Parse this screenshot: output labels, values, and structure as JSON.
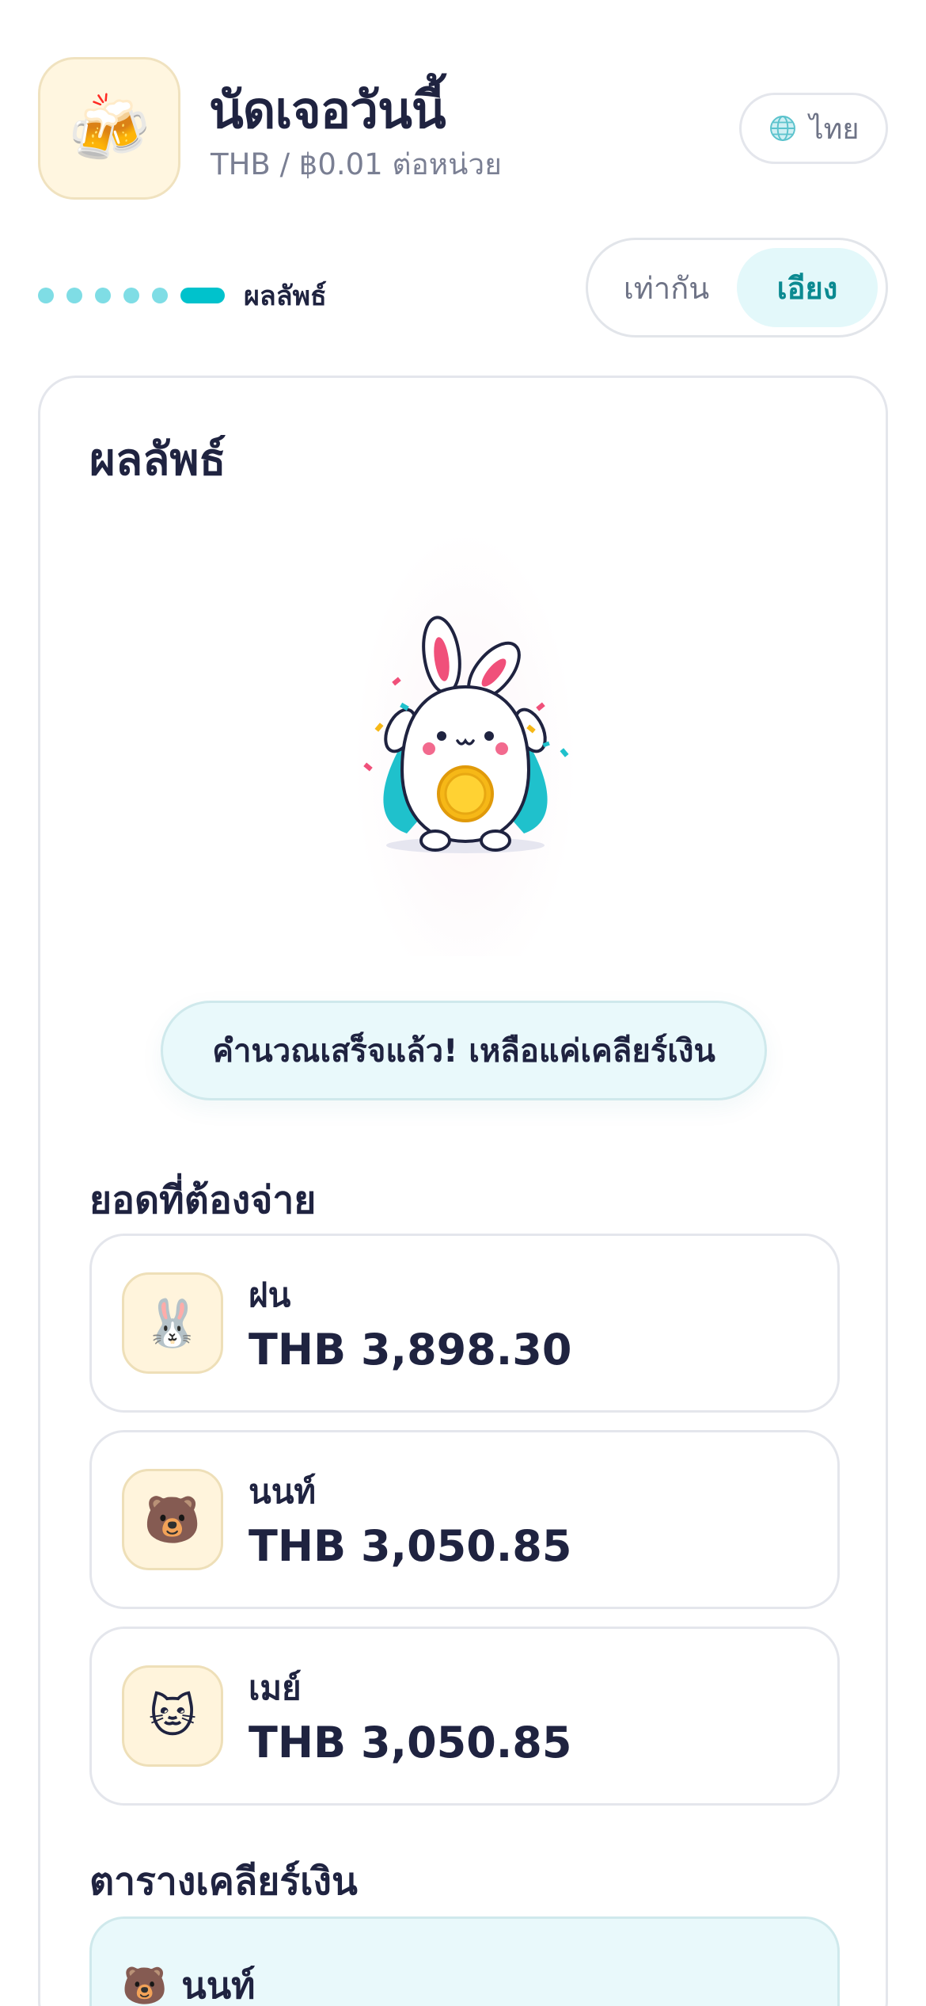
{
  "header": {
    "app_icon": "beer-mugs-icon",
    "app_icon_glyph": "🍻",
    "title": "นัดเจอวันนี้",
    "subtitle": "THB / ฿0.01 ต่อหน่วย",
    "language_label": "ไทย",
    "language_icon": "globe-icon"
  },
  "progress": {
    "total_steps": 6,
    "current_step": 6,
    "current_label": "ผลลัพธ์"
  },
  "rounding_toggle": {
    "options": [
      "เท่ากัน",
      "เอียง"
    ],
    "selected": "เอียง"
  },
  "result": {
    "title": "ผลลัพธ์",
    "illustration": "celebrating-bunny-with-coin",
    "banner": "คำนวณเสร็จแล้ว! เหลือแค่เคลียร์เงิน"
  },
  "payments": {
    "heading": "ยอดที่ต้องจ่าย",
    "items": [
      {
        "avatar": "rabbit-icon",
        "emoji": "🐰",
        "name": "ฝน",
        "amount": "THB 3,898.30"
      },
      {
        "avatar": "bear-icon",
        "emoji": "🐻",
        "name": "นนท์",
        "amount": "THB 3,050.85"
      },
      {
        "avatar": "cat-icon",
        "emoji": "🐱",
        "name": "เมย์",
        "amount": "THB 3,050.85"
      }
    ]
  },
  "settlement": {
    "heading": "ตารางเคลียร์เงิน",
    "first_row": {
      "avatar": "bear-icon",
      "emoji": "🐻",
      "name": "นนท์"
    }
  },
  "colors": {
    "accent": "#00c2cc",
    "accent_light": "#e3f8fa",
    "text": "#1f2340",
    "muted": "#7a7f93",
    "avatar_bg": "#fff4dc"
  }
}
